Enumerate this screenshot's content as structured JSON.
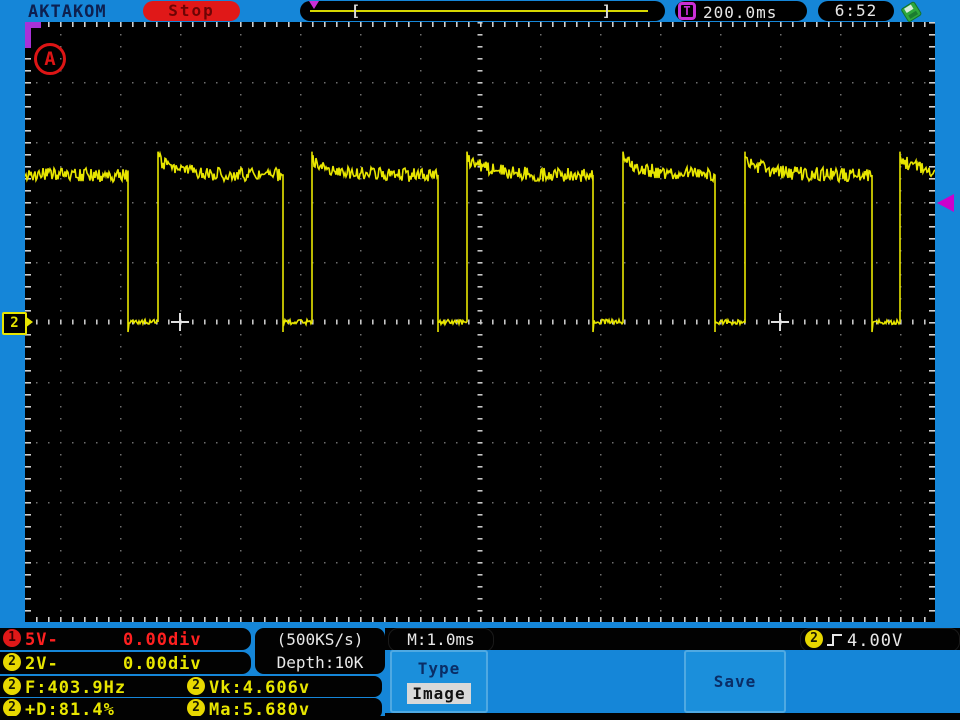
{
  "header": {
    "brand": "AKTAKOM",
    "run_state": "Stop",
    "trigbar": {
      "left_bracket": "[",
      "right_bracket": "]"
    },
    "trigger_icon_letter": "T",
    "trigger_time": "200.0ms",
    "clock": "6:52"
  },
  "screen": {
    "auto_indicator": "A",
    "ch2_marker_label": "2"
  },
  "chart_data": {
    "type": "line",
    "title": "CH2 square wave, stopped acquisition",
    "x_units": "ms",
    "y_units": "V",
    "timebase_ms_per_div": 1.0,
    "volts_per_div": 2.0,
    "h_divisions": 15.17,
    "v_divisions": 10,
    "x_range_ms": [
      0,
      15.17
    ],
    "ch2_zero_v": 0.0,
    "high_v": 4.9,
    "low_v": 0.0,
    "overshoot_peak_v": 5.68,
    "trigger_level_v": 4.0,
    "falling_edges_ms": [
      1.717,
      4.3,
      6.883,
      9.467,
      11.5,
      14.117
    ],
    "rising_edges_ms": [
      2.217,
      4.783,
      7.367,
      9.967,
      12.0,
      14.583
    ],
    "measured": {
      "frequency_hz": 403.9,
      "duty_pos_pct": 81.4,
      "vk_v": 4.606,
      "ma_v": 5.68
    }
  },
  "footer": {
    "ch1": {
      "num": "1",
      "scale": "5V-",
      "offset": "0.00div"
    },
    "ch2": {
      "num": "2",
      "scale": "2V-",
      "offset": "0.00div"
    },
    "acquisition": {
      "sample_rate": "(500KS/s)",
      "depth": "Depth:10K"
    },
    "timebase": "M:1.0ms",
    "trigger": {
      "ch": "2",
      "level": "4.00V"
    },
    "measurements": [
      {
        "ch": "2",
        "label": "F:403.9Hz"
      },
      {
        "ch": "2",
        "label": "Vk:4.606v"
      },
      {
        "ch": "2",
        "label": "+D:81.4%"
      },
      {
        "ch": "2",
        "label": "Ma:5.680v"
      }
    ],
    "menu": {
      "type_label": "Type",
      "type_value": "Image",
      "save_label": "Save"
    }
  },
  "colors": {
    "chrome_blue": "#1586d8",
    "trace_yellow": "#e8e600",
    "ch1_red": "#ff2020",
    "stop_red": "#e01818",
    "trigger_magenta": "#cc00cc",
    "purple": "#cb2fd6",
    "usb_green": "#2fa83c"
  }
}
